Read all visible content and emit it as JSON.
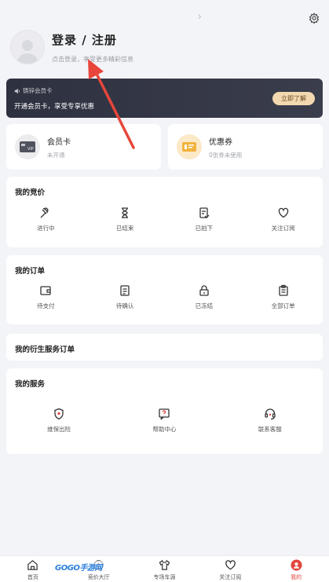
{
  "profile": {
    "title": "登录 / 注册",
    "subtitle": "点击登录，享受更多精彩信息"
  },
  "vip_banner": {
    "tag": "铸锌会员卡",
    "desc": "开通会员卡，享受专享优惠",
    "button": "立即了解"
  },
  "cards": {
    "member": {
      "title": "会员卡",
      "sub": "未开通"
    },
    "coupon": {
      "title": "优惠券",
      "sub": "0张券未使用"
    }
  },
  "bidding": {
    "title": "我的竞价",
    "items": [
      {
        "label": "进行中",
        "icon": "gavel-icon"
      },
      {
        "label": "已结束",
        "icon": "hourglass-icon"
      },
      {
        "label": "已拍下",
        "icon": "document-check-icon"
      },
      {
        "label": "关注订阅",
        "icon": "heart-icon"
      }
    ]
  },
  "orders": {
    "title": "我的订单",
    "items": [
      {
        "label": "待支付",
        "icon": "wallet-icon"
      },
      {
        "label": "待确认",
        "icon": "document-icon"
      },
      {
        "label": "已冻结",
        "icon": "lock-icon"
      },
      {
        "label": "全部订单",
        "icon": "clipboard-icon"
      }
    ]
  },
  "derivative": {
    "title": "我的衍生服务订单"
  },
  "services": {
    "title": "我的服务",
    "items": [
      {
        "label": "维保出险",
        "icon": "shield-icon"
      },
      {
        "label": "帮助中心",
        "icon": "question-icon"
      },
      {
        "label": "联系客服",
        "icon": "headset-icon"
      }
    ]
  },
  "tabbar": {
    "items": [
      {
        "label": "首页",
        "icon": "home-icon"
      },
      {
        "label": "竞价大厅",
        "icon": "hall-icon"
      },
      {
        "label": "专场车源",
        "icon": "tshirt-icon"
      },
      {
        "label": "关注订阅",
        "icon": "heart-icon"
      },
      {
        "label": "我的",
        "icon": "user-icon",
        "active": true
      }
    ]
  },
  "watermark": "GOGO手游网",
  "colors": {
    "accent": "#e2463d",
    "vip_bg": "#2e3140",
    "vip_button": "#f2d8b0",
    "annotation_arrow": "#e8463b"
  }
}
